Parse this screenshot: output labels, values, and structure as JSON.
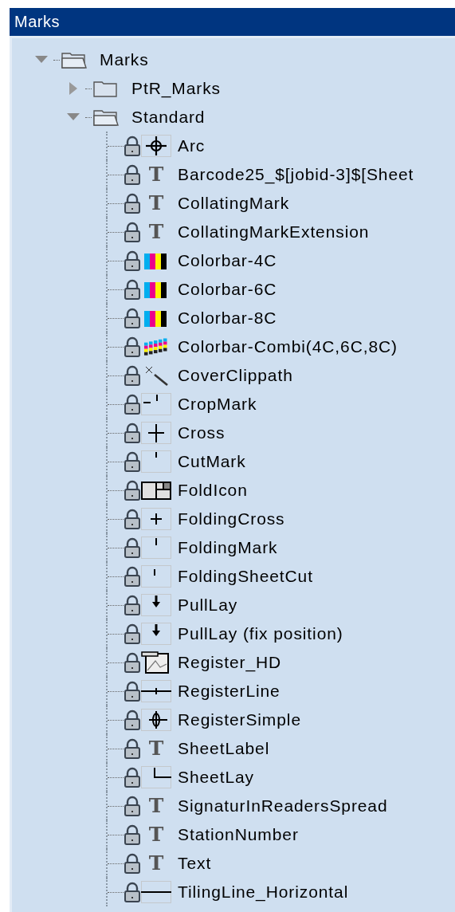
{
  "title": "Marks",
  "tree": [
    {
      "label": "Marks",
      "kind": "folder",
      "expanded": true,
      "children": [
        {
          "label": "PtR_Marks",
          "kind": "folder",
          "expanded": false
        },
        {
          "label": "Standard",
          "kind": "folder",
          "expanded": true,
          "children": [
            {
              "label": "Arc",
              "kind": "crosshair",
              "locked": true
            },
            {
              "label": "Barcode25_$[jobid-3]$[Sheet",
              "kind": "text",
              "glyph": "T",
              "locked": true
            },
            {
              "label": "CollatingMark",
              "kind": "text",
              "glyph": "T",
              "locked": true
            },
            {
              "label": "CollatingMarkExtension",
              "kind": "text",
              "glyph": "T",
              "locked": true
            },
            {
              "label": "Colorbar-4C",
              "kind": "colorbar",
              "locked": true
            },
            {
              "label": "Colorbar-6C",
              "kind": "colorbar",
              "locked": true
            },
            {
              "label": "Colorbar-8C",
              "kind": "colorbar",
              "locked": true
            },
            {
              "label": "Colorbar-Combi(4C,6C,8C)",
              "kind": "colorbars",
              "locked": true
            },
            {
              "label": "CoverClippath",
              "kind": "wand",
              "locked": true
            },
            {
              "label": "CropMark",
              "kind": "cropmark",
              "locked": true
            },
            {
              "label": "Cross",
              "kind": "cross",
              "locked": true
            },
            {
              "label": "CutMark",
              "kind": "cutmark",
              "locked": true
            },
            {
              "label": "FoldIcon",
              "kind": "foldicon",
              "locked": true
            },
            {
              "label": "FoldingCross",
              "kind": "smallcross",
              "locked": true
            },
            {
              "label": "FoldingMark",
              "kind": "foldmark",
              "locked": true
            },
            {
              "label": "FoldingSheetCut",
              "kind": "sheetcut",
              "locked": true
            },
            {
              "label": "PullLay",
              "kind": "arrow",
              "locked": true
            },
            {
              "label": "PullLay (fix position)",
              "kind": "arrow",
              "locked": true
            },
            {
              "label": "Register_HD",
              "kind": "image",
              "locked": true
            },
            {
              "label": "RegisterLine",
              "kind": "registerline",
              "locked": true
            },
            {
              "label": "RegisterSimple",
              "kind": "register",
              "locked": true
            },
            {
              "label": "SheetLabel",
              "kind": "text",
              "glyph": "T",
              "locked": true
            },
            {
              "label": "SheetLay",
              "kind": "corner",
              "locked": true
            },
            {
              "label": "SignaturInReadersSpread",
              "kind": "text",
              "glyph": "T",
              "locked": true
            },
            {
              "label": "StationNumber",
              "kind": "text",
              "glyph": "T",
              "locked": true
            },
            {
              "label": "Text",
              "kind": "text",
              "glyph": "T",
              "locked": true
            },
            {
              "label": "TilingLine_Horizontal",
              "kind": "line",
              "locked": true
            }
          ]
        }
      ]
    }
  ]
}
